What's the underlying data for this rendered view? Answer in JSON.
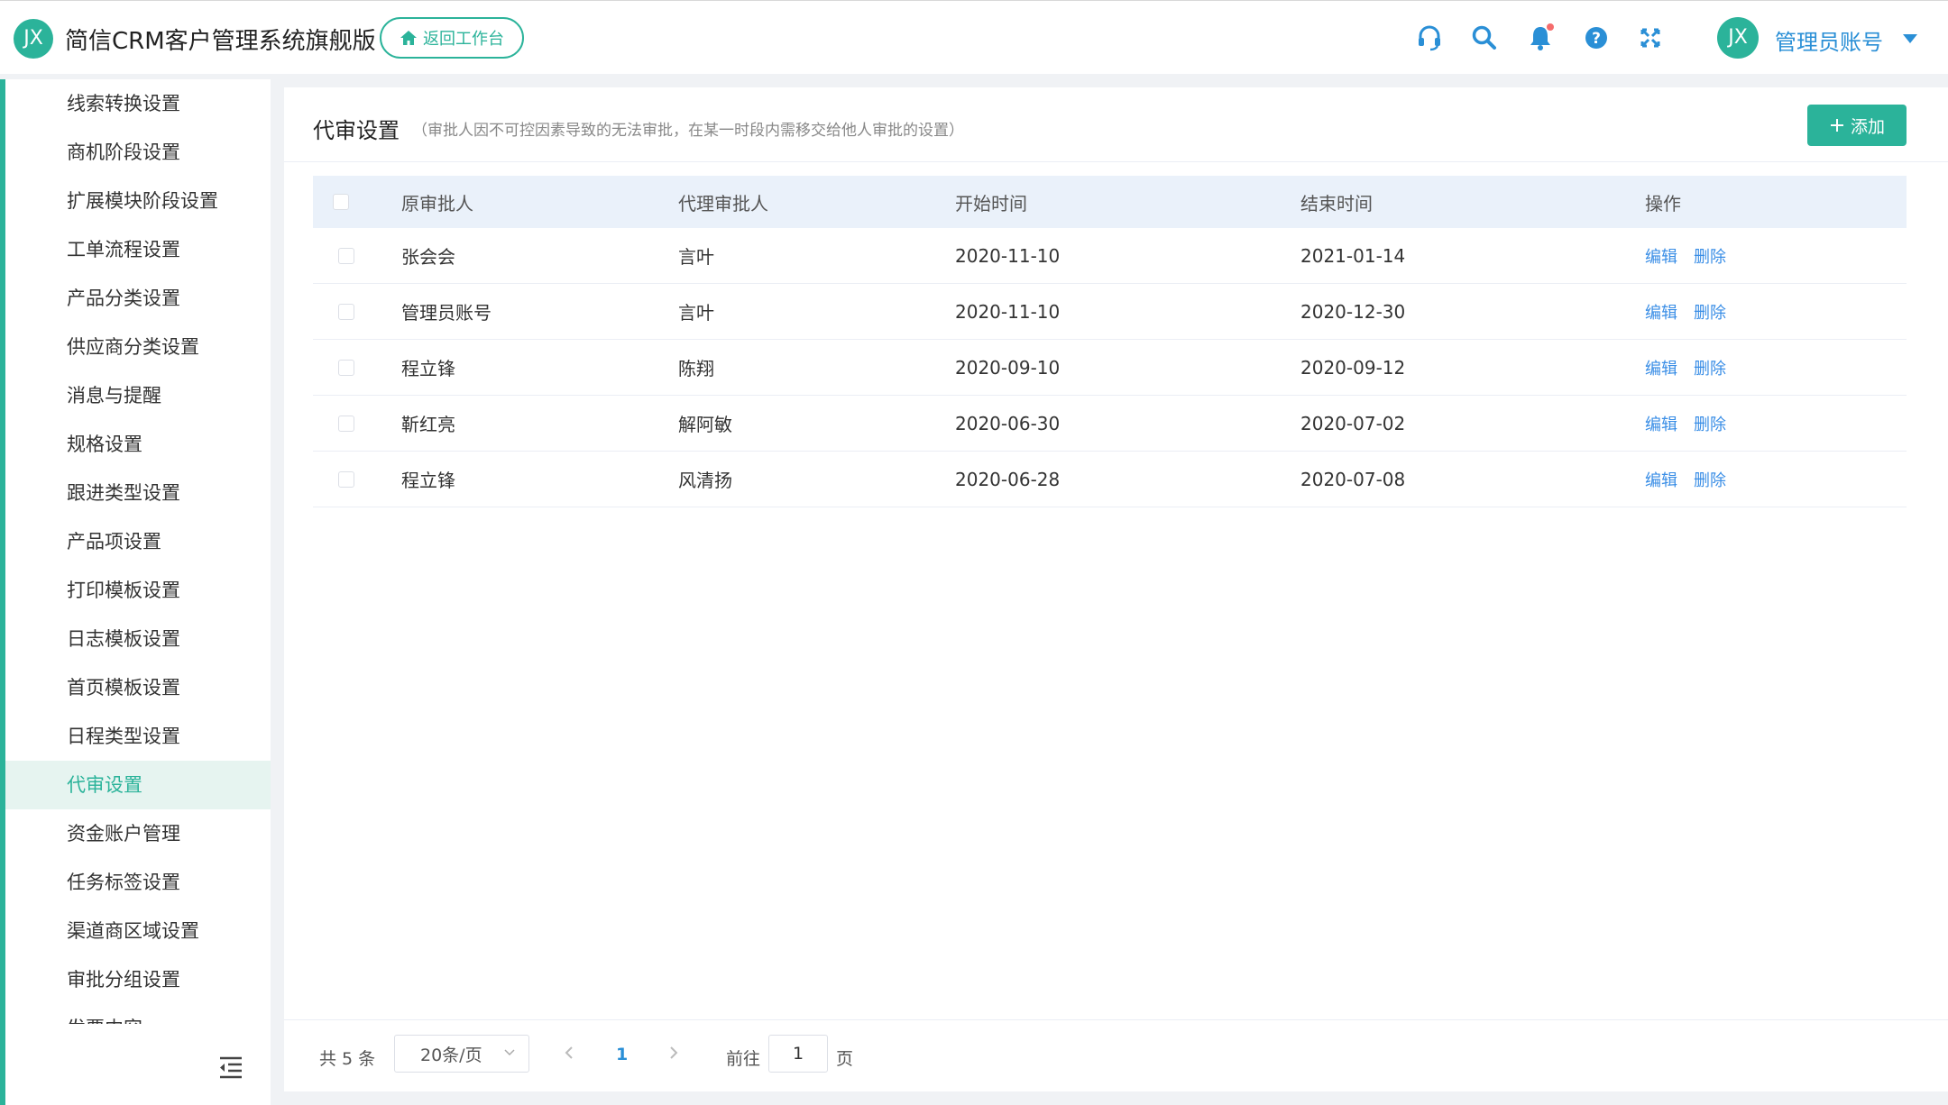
{
  "header": {
    "logo_text": "JX",
    "app_title": "简信CRM客户管理系统旗舰版",
    "back_button": "返回工作台",
    "icons": [
      "headset-icon",
      "search-icon",
      "bell-icon",
      "help-icon",
      "fullscreen-icon"
    ],
    "avatar_text": "JX",
    "user_name": "管理员账号"
  },
  "sidebar": {
    "items": [
      {
        "label": "线索转换设置"
      },
      {
        "label": "商机阶段设置"
      },
      {
        "label": "扩展模块阶段设置"
      },
      {
        "label": "工单流程设置"
      },
      {
        "label": "产品分类设置"
      },
      {
        "label": "供应商分类设置"
      },
      {
        "label": "消息与提醒"
      },
      {
        "label": "规格设置"
      },
      {
        "label": "跟进类型设置"
      },
      {
        "label": "产品项设置"
      },
      {
        "label": "打印模板设置"
      },
      {
        "label": "日志模板设置"
      },
      {
        "label": "首页模板设置"
      },
      {
        "label": "日程类型设置"
      },
      {
        "label": "代审设置",
        "active": true
      },
      {
        "label": "资金账户管理"
      },
      {
        "label": "任务标签设置"
      },
      {
        "label": "渠道商区域设置"
      },
      {
        "label": "审批分组设置"
      },
      {
        "label": "发票内容"
      }
    ]
  },
  "page": {
    "title": "代审设置",
    "description": "（审批人因不可控因素导致的无法审批，在某一时段内需移交给他人审批的设置）",
    "add_button": "添加"
  },
  "table": {
    "columns": [
      "原审批人",
      "代理审批人",
      "开始时间",
      "结束时间",
      "操作"
    ],
    "rows": [
      {
        "original": "张会会",
        "proxy": "言叶",
        "start": "2020-11-10",
        "end": "2021-01-14"
      },
      {
        "original": "管理员账号",
        "proxy": "言叶",
        "start": "2020-11-10",
        "end": "2020-12-30"
      },
      {
        "original": "程立锋",
        "proxy": "陈翔",
        "start": "2020-09-10",
        "end": "2020-09-12"
      },
      {
        "original": "靳红亮",
        "proxy": "解阿敏",
        "start": "2020-06-30",
        "end": "2020-07-02"
      },
      {
        "original": "程立锋",
        "proxy": "风清扬",
        "start": "2020-06-28",
        "end": "2020-07-08"
      }
    ],
    "actions": {
      "edit": "编辑",
      "delete": "删除"
    }
  },
  "pagination": {
    "total": "共 5 条",
    "page_size": "20条/页",
    "current_page": "1",
    "goto_label": "前往",
    "goto_value": "1",
    "page_suffix": "页"
  },
  "colors": {
    "accent": "#2bb39a",
    "link": "#2a8fd6",
    "header_row": "#eaf1fa"
  }
}
